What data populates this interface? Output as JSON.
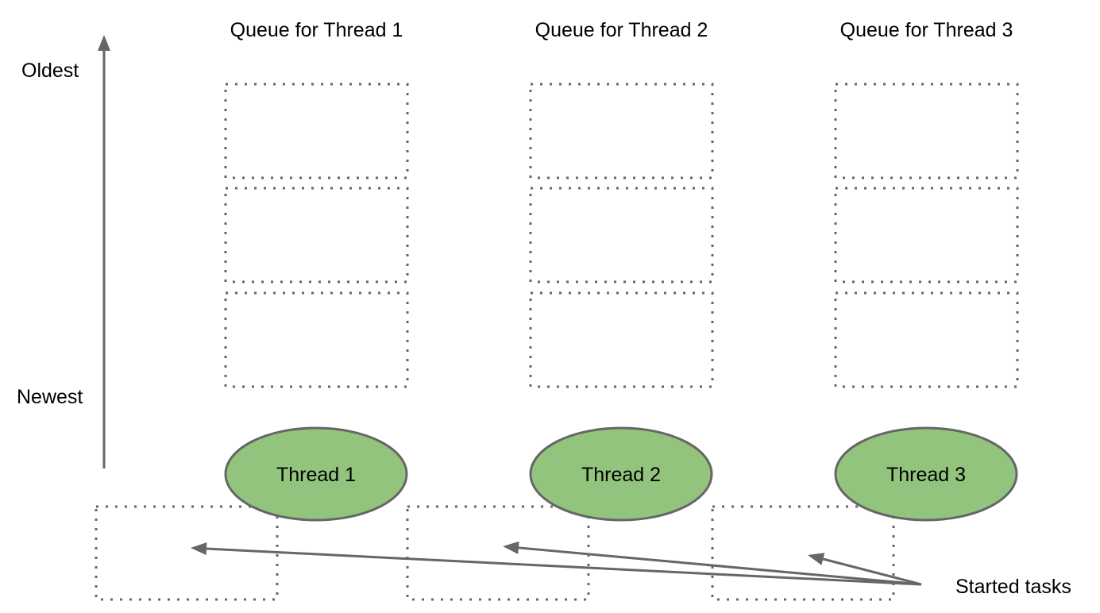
{
  "axis": {
    "top_label": "Oldest",
    "bottom_label": "Newest",
    "direction": "up"
  },
  "queues": [
    {
      "title": "Queue for Thread 1",
      "thread_label": "Thread 1",
      "slots": 3
    },
    {
      "title": "Queue for Thread 2",
      "thread_label": "Thread 2",
      "slots": 3
    },
    {
      "title": "Queue for Thread 3",
      "thread_label": "Thread 3",
      "slots": 3
    }
  ],
  "started_tasks": {
    "label": "Started tasks",
    "count": 3
  },
  "colors": {
    "thread_fill": "#93c47d",
    "stroke": "#666666",
    "text": "#000000"
  }
}
